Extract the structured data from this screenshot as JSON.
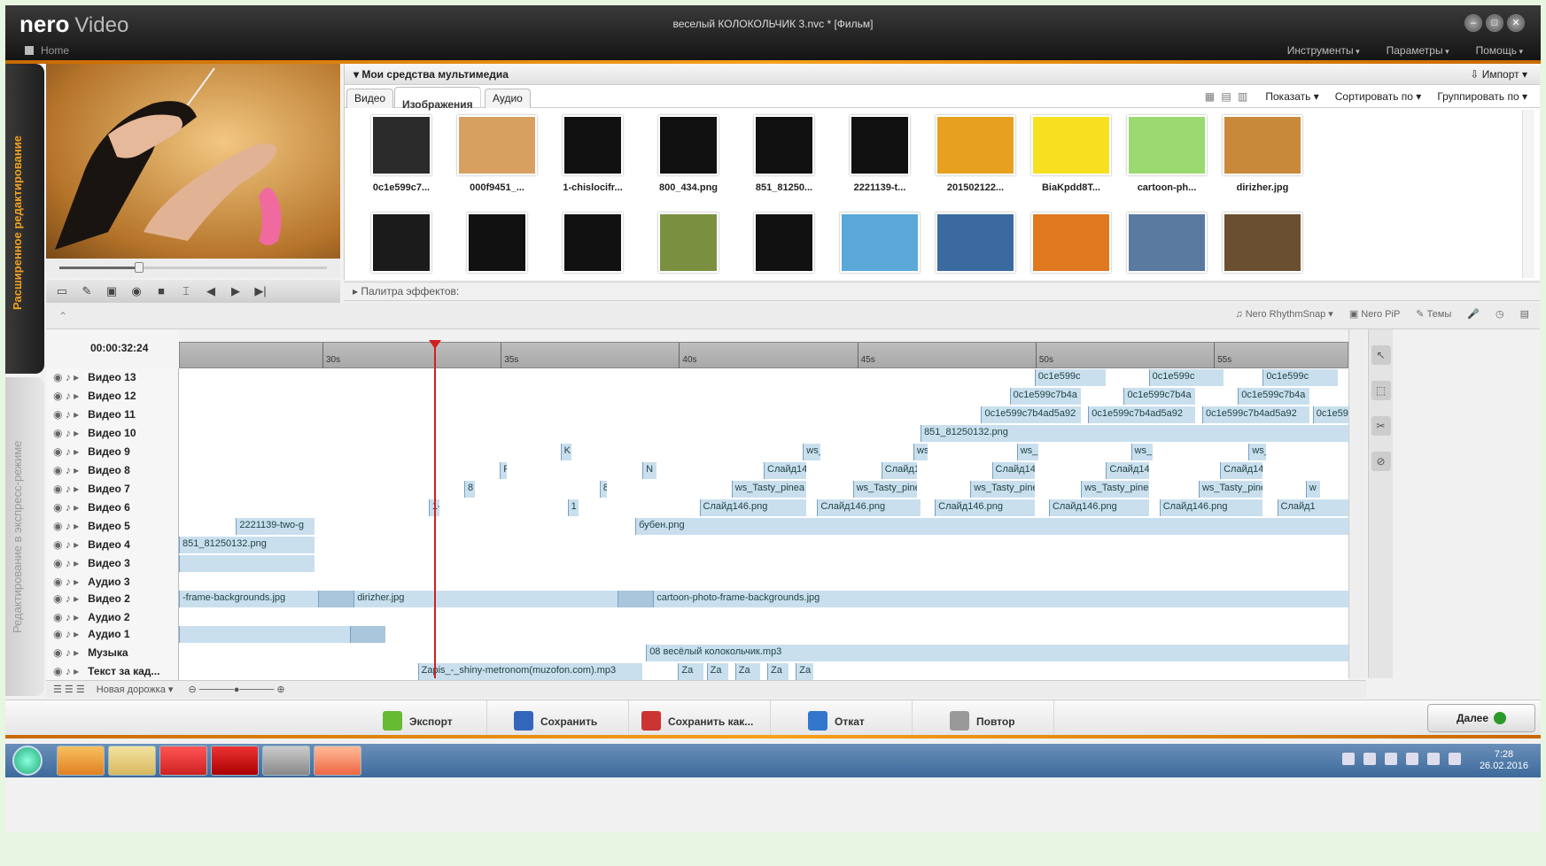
{
  "app": {
    "brand": "nero",
    "brand_sub": "Video",
    "title": "веселый КОЛОКОЛЬЧИК 3.nvc * [Фильм]",
    "home": "Home"
  },
  "menu": [
    "Инструменты",
    "Параметры",
    "Помощь"
  ],
  "window_buttons": [
    "minimize-icon",
    "restore-icon",
    "close-icon"
  ],
  "side_tabs": {
    "advanced": "Расширенное редактирование",
    "express": "Редактирование в экспресс-режиме"
  },
  "media": {
    "header": "Мои средства мультимедиа",
    "import": "Импорт",
    "tabs": [
      "Видео",
      "Изображения",
      "Аудио"
    ],
    "active_tab": "Изображения",
    "tools": {
      "show": "Показать",
      "sort": "Сортировать по",
      "group": "Группировать по"
    },
    "thumbs_row1": [
      "0c1e599c7...",
      "000f9451_...",
      "1-chislocifr...",
      "800_434.png",
      "851_81250...",
      "2221139-t...",
      "201502122...",
      "BiaKpdd8T...",
      "cartoon-ph...",
      "dirizher.jpg"
    ],
    "thumb_colors_row1": [
      "#2b2b2b",
      "#d8a060",
      "#111111",
      "#111111",
      "#111111",
      "#111111",
      "#e8a020",
      "#f6e020",
      "#9ad870",
      "#c88a3a"
    ],
    "thumb_colors_row2": [
      "#1b1b1b",
      "#111111",
      "#111111",
      "#7a9040",
      "#111111",
      "#5aa8d8",
      "#3a6aa0",
      "#e07820",
      "#5a7aa0",
      "#6a5030"
    ]
  },
  "effects_palette": "Палитра эффектов:",
  "timeline": {
    "timecode": "00:00:32:24",
    "ruler_labels": [
      "30s",
      "35s",
      "40s",
      "45s",
      "50s",
      "55s"
    ],
    "ruler_start_seconds": 26,
    "ruler_end_seconds": 58.8,
    "playhead_seconds": 33,
    "tools": [
      "Nero RhythmSnap",
      "Nero PiP",
      "Темы"
    ],
    "tracks": [
      {
        "name": "Видео 13",
        "clips": [
          {
            "label": "0c1e599c",
            "start": 50,
            "end": 52
          },
          {
            "label": "0c1e599c",
            "start": 53.2,
            "end": 55.3
          },
          {
            "label": "0c1e599c",
            "start": 56.4,
            "end": 58.5
          }
        ]
      },
      {
        "name": "Видео 12",
        "clips": [
          {
            "label": "0c1e599c7b4a",
            "start": 49.3,
            "end": 51.3
          },
          {
            "label": "0c1e599c7b4a",
            "start": 52.5,
            "end": 54.5
          },
          {
            "label": "0c1e599c7b4a",
            "start": 55.7,
            "end": 57.7
          }
        ]
      },
      {
        "name": "Видео 11",
        "clips": [
          {
            "label": "0c1e599c7b4ad5a92",
            "start": 48.5,
            "end": 51.3
          },
          {
            "label": "0c1e599c7b4ad5a92",
            "start": 51.5,
            "end": 54.5
          },
          {
            "label": "0c1e599c7b4ad5a92",
            "start": 54.7,
            "end": 57.7
          },
          {
            "label": "0c1e59",
            "start": 57.8,
            "end": 58.8
          }
        ]
      },
      {
        "name": "Видео 10",
        "clips": [
          {
            "label": "851_81250132.png",
            "start": 46.8,
            "end": 58.8
          }
        ]
      },
      {
        "name": "Видео 9",
        "clips": [
          {
            "label": "K",
            "start": 36.7,
            "end": 37
          },
          {
            "label": "ws_",
            "start": 43.5,
            "end": 44
          },
          {
            "label": "ws",
            "start": 46.6,
            "end": 47
          },
          {
            "label": "ws_",
            "start": 49.5,
            "end": 50.1
          },
          {
            "label": "ws_1",
            "start": 52.7,
            "end": 53.3
          },
          {
            "label": "ws_",
            "start": 56,
            "end": 56.5
          }
        ]
      },
      {
        "name": "Видео 8",
        "clips": [
          {
            "label": "R",
            "start": 35,
            "end": 35.2
          },
          {
            "label": "N",
            "start": 39,
            "end": 39.4
          },
          {
            "label": "Слайд14",
            "start": 42.4,
            "end": 43.6
          },
          {
            "label": "Слайд14",
            "start": 45.7,
            "end": 46.7
          },
          {
            "label": "Слайд14",
            "start": 48.8,
            "end": 50
          },
          {
            "label": "Слайд14",
            "start": 52,
            "end": 53.2
          },
          {
            "label": "Слайд14",
            "start": 55.2,
            "end": 56.4
          }
        ]
      },
      {
        "name": "Видео 7",
        "clips": [
          {
            "label": "8",
            "start": 34,
            "end": 34.3
          },
          {
            "label": "8",
            "start": 37.8,
            "end": 38
          },
          {
            "label": "ws_Tasty_pinea",
            "start": 41.5,
            "end": 43.6
          },
          {
            "label": "ws_Tasty_pine",
            "start": 44.9,
            "end": 46.7
          },
          {
            "label": "ws_Tasty_pinea",
            "start": 48.2,
            "end": 50
          },
          {
            "label": "ws_Tasty_pinea",
            "start": 51.3,
            "end": 53.2
          },
          {
            "label": "ws_Tasty_pinea",
            "start": 54.6,
            "end": 56.4
          },
          {
            "label": "w",
            "start": 57.6,
            "end": 58
          }
        ]
      },
      {
        "name": "Видео 6",
        "clips": [
          {
            "label": "1-",
            "start": 33,
            "end": 33.3
          },
          {
            "label": "1",
            "start": 36.9,
            "end": 37.2
          },
          {
            "label": "Слайд146.png",
            "start": 40.6,
            "end": 43.6
          },
          {
            "label": "Слайд146.png",
            "start": 43.9,
            "end": 46.8
          },
          {
            "label": "Слайд146.png",
            "start": 47.2,
            "end": 50
          },
          {
            "label": "Слайд146.png",
            "start": 50.4,
            "end": 53.2
          },
          {
            "label": "Слайд146.png",
            "start": 53.5,
            "end": 56.4
          },
          {
            "label": "Слайд1",
            "start": 56.8,
            "end": 58.8
          }
        ]
      },
      {
        "name": "Видео 5",
        "clips": [
          {
            "label": "2221139-two-g",
            "start": 27.6,
            "end": 29.8
          },
          {
            "label": "бубен.png",
            "start": 38.8,
            "end": 58.8
          }
        ]
      },
      {
        "name": "Видео 4",
        "clips": [
          {
            "label": "851_81250132.png",
            "start": 26,
            "end": 29.8
          }
        ]
      },
      {
        "name": "Видео 3",
        "clips": [
          {
            "label": "",
            "start": 26,
            "end": 29.8
          }
        ]
      },
      {
        "name": "Аудио 3",
        "clips": []
      },
      {
        "name": "Видео 2",
        "clips": [
          {
            "label": "-frame-backgrounds.jpg",
            "start": 26,
            "end": 29.9
          },
          {
            "label": "",
            "start": 29.9,
            "end": 30.9,
            "dark": true
          },
          {
            "label": "dirizher.jpg",
            "start": 30.9,
            "end": 38.3
          },
          {
            "label": "",
            "start": 38.3,
            "end": 39.3,
            "dark": true
          },
          {
            "label": "cartoon-photo-frame-backgrounds.jpg",
            "start": 39.3,
            "end": 58.8
          }
        ]
      },
      {
        "name": "Аудио 2",
        "clips": []
      },
      {
        "name": "Аудио 1",
        "clips": [
          {
            "label": "",
            "start": 26,
            "end": 30.8
          },
          {
            "label": "",
            "start": 30.8,
            "end": 31.8,
            "dark": true
          }
        ]
      },
      {
        "name": "Музыка",
        "clips": [
          {
            "label": "08 весёлый колокольчик.mp3",
            "start": 39.1,
            "end": 58.8
          }
        ]
      },
      {
        "name": "Текст за кад...",
        "clips": [
          {
            "label": "Zapis_-_shiny-metronom(muzofon.com).mp3",
            "start": 32.7,
            "end": 39
          },
          {
            "label": "Za",
            "start": 40,
            "end": 40.7
          },
          {
            "label": "Za",
            "start": 40.8,
            "end": 41.4
          },
          {
            "label": "Za",
            "start": 41.6,
            "end": 42.3
          },
          {
            "label": "Za",
            "start": 42.5,
            "end": 43.1
          },
          {
            "label": "Za",
            "start": 43.3,
            "end": 43.8
          }
        ]
      }
    ],
    "footer": "Новая дорожка"
  },
  "actions": [
    "Экспорт",
    "Сохранить",
    "Сохранить как...",
    "Откат",
    "Повтор"
  ],
  "action_icons": [
    "export-icon",
    "save-icon",
    "save-as-icon",
    "undo-icon",
    "redo-icon"
  ],
  "next": "Далее",
  "clock": {
    "time": "7:28",
    "date": "26.02.2016"
  }
}
